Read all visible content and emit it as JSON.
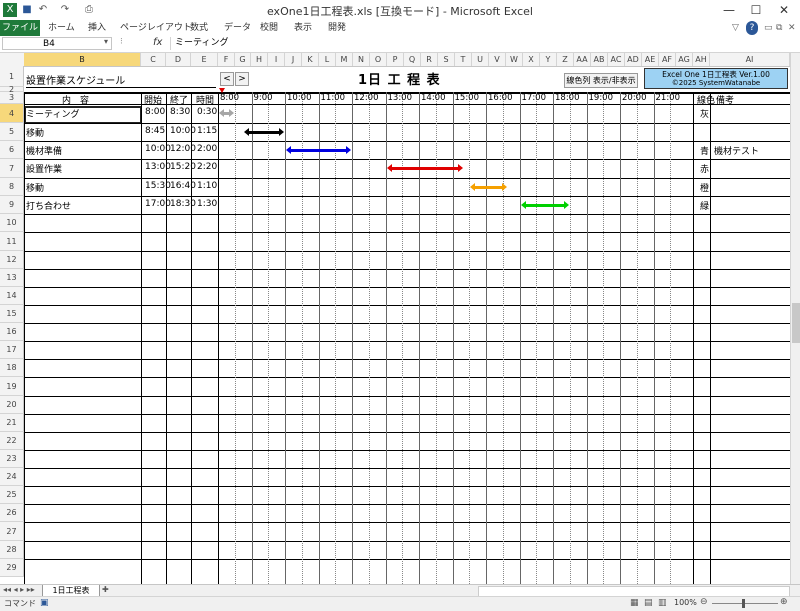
{
  "window": {
    "title": "exOne1日工程表.xls  [互換モード]  -  Microsoft Excel"
  },
  "ribbon": {
    "file": "ファイル",
    "tabs": [
      "ホーム",
      "挿入",
      "ページレイアウト",
      "数式",
      "データ",
      "校閲",
      "表示",
      "開発"
    ]
  },
  "formula_bar": {
    "name_box": "B4",
    "fx": "fx",
    "value": "ミーティング"
  },
  "columns": [
    "B",
    "C",
    "D",
    "E",
    "F",
    "G",
    "H",
    "I",
    "J",
    "K",
    "L",
    "M",
    "N",
    "O",
    "P",
    "Q",
    "R",
    "S",
    "T",
    "U",
    "V",
    "W",
    "X",
    "Y",
    "Z",
    "AA",
    "AB",
    "AC",
    "AD",
    "AE",
    "AF",
    "AG",
    "AH",
    "AI"
  ],
  "rows": [
    "1",
    "2",
    "3",
    "4",
    "5",
    "6",
    "7",
    "8",
    "9",
    "10",
    "11",
    "12",
    "13",
    "14",
    "15",
    "16",
    "17",
    "18",
    "19",
    "20",
    "21",
    "22",
    "23",
    "24",
    "25",
    "26",
    "27",
    "28",
    "29"
  ],
  "sheet": {
    "heading": "設置作業スケジュール",
    "title": "1日 工 程 表",
    "nav_prev": "<",
    "nav_next": ">",
    "toggle_button": "線色列 表示/非表示",
    "info_line1": "Excel One 1日工程表 Ver.1.00",
    "info_line2": "©2025 SystemWatanabe",
    "header": {
      "content": "内　容",
      "start": "開始",
      "end": "終了",
      "duration": "時間",
      "color": "線色",
      "note": "備考"
    },
    "times": [
      "8:00",
      "9:00",
      "10:00",
      "11:00",
      "12:00",
      "13:00",
      "14:00",
      "15:00",
      "16:00",
      "17:00",
      "18:00",
      "19:00",
      "20:00",
      "21:00"
    ],
    "tasks": [
      {
        "name": "ミーティング",
        "start": "8:00",
        "end": "8:30",
        "duration": "0:30",
        "color_label": "灰",
        "color": "#a6a6a6",
        "note": "",
        "start_h": 8.0,
        "end_h": 8.5
      },
      {
        "name": "移動",
        "start": "8:45",
        "end": "10:00",
        "duration": "1:15",
        "color_label": "",
        "color": "#000000",
        "note": "",
        "start_h": 8.75,
        "end_h": 10.0
      },
      {
        "name": "機材準備",
        "start": "10:00",
        "end": "12:00",
        "duration": "2:00",
        "color_label": "青",
        "color": "#0000e0",
        "note": "機材テスト",
        "start_h": 10.0,
        "end_h": 12.0
      },
      {
        "name": "設置作業",
        "start": "13:00",
        "end": "15:20",
        "duration": "2:20",
        "color_label": "赤",
        "color": "#e00000",
        "note": "",
        "start_h": 13.0,
        "end_h": 15.333
      },
      {
        "name": "移動",
        "start": "15:30",
        "end": "16:40",
        "duration": "1:10",
        "color_label": "橙",
        "color": "#f5a000",
        "note": "",
        "start_h": 15.5,
        "end_h": 16.667
      },
      {
        "name": "打ち合わせ",
        "start": "17:00",
        "end": "18:30",
        "duration": "1:30",
        "color_label": "緑",
        "color": "#00d000",
        "note": "",
        "start_h": 17.0,
        "end_h": 18.5
      }
    ]
  },
  "sheet_tab": "1日工程表",
  "status": {
    "mode": "コマンド",
    "zoom": "100%"
  }
}
